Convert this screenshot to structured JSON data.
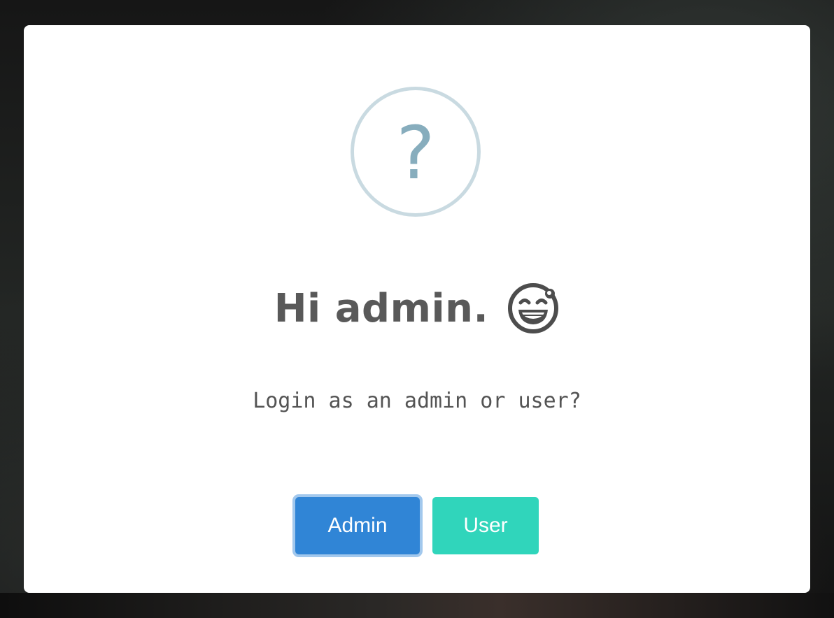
{
  "dialog": {
    "icon": "question-icon",
    "icon_glyph": "?",
    "title": "Hi admin.",
    "title_emoji": "grinning-face-sweat-icon",
    "message": "Login as an admin or user?",
    "buttons": {
      "admin_label": "Admin",
      "user_label": "User"
    }
  },
  "colors": {
    "confirm_button": "#3085d6",
    "alt_button": "#30d5bb",
    "icon_ring": "#c9dae1",
    "icon_glyph": "#87adbd",
    "title_text": "#595959"
  }
}
